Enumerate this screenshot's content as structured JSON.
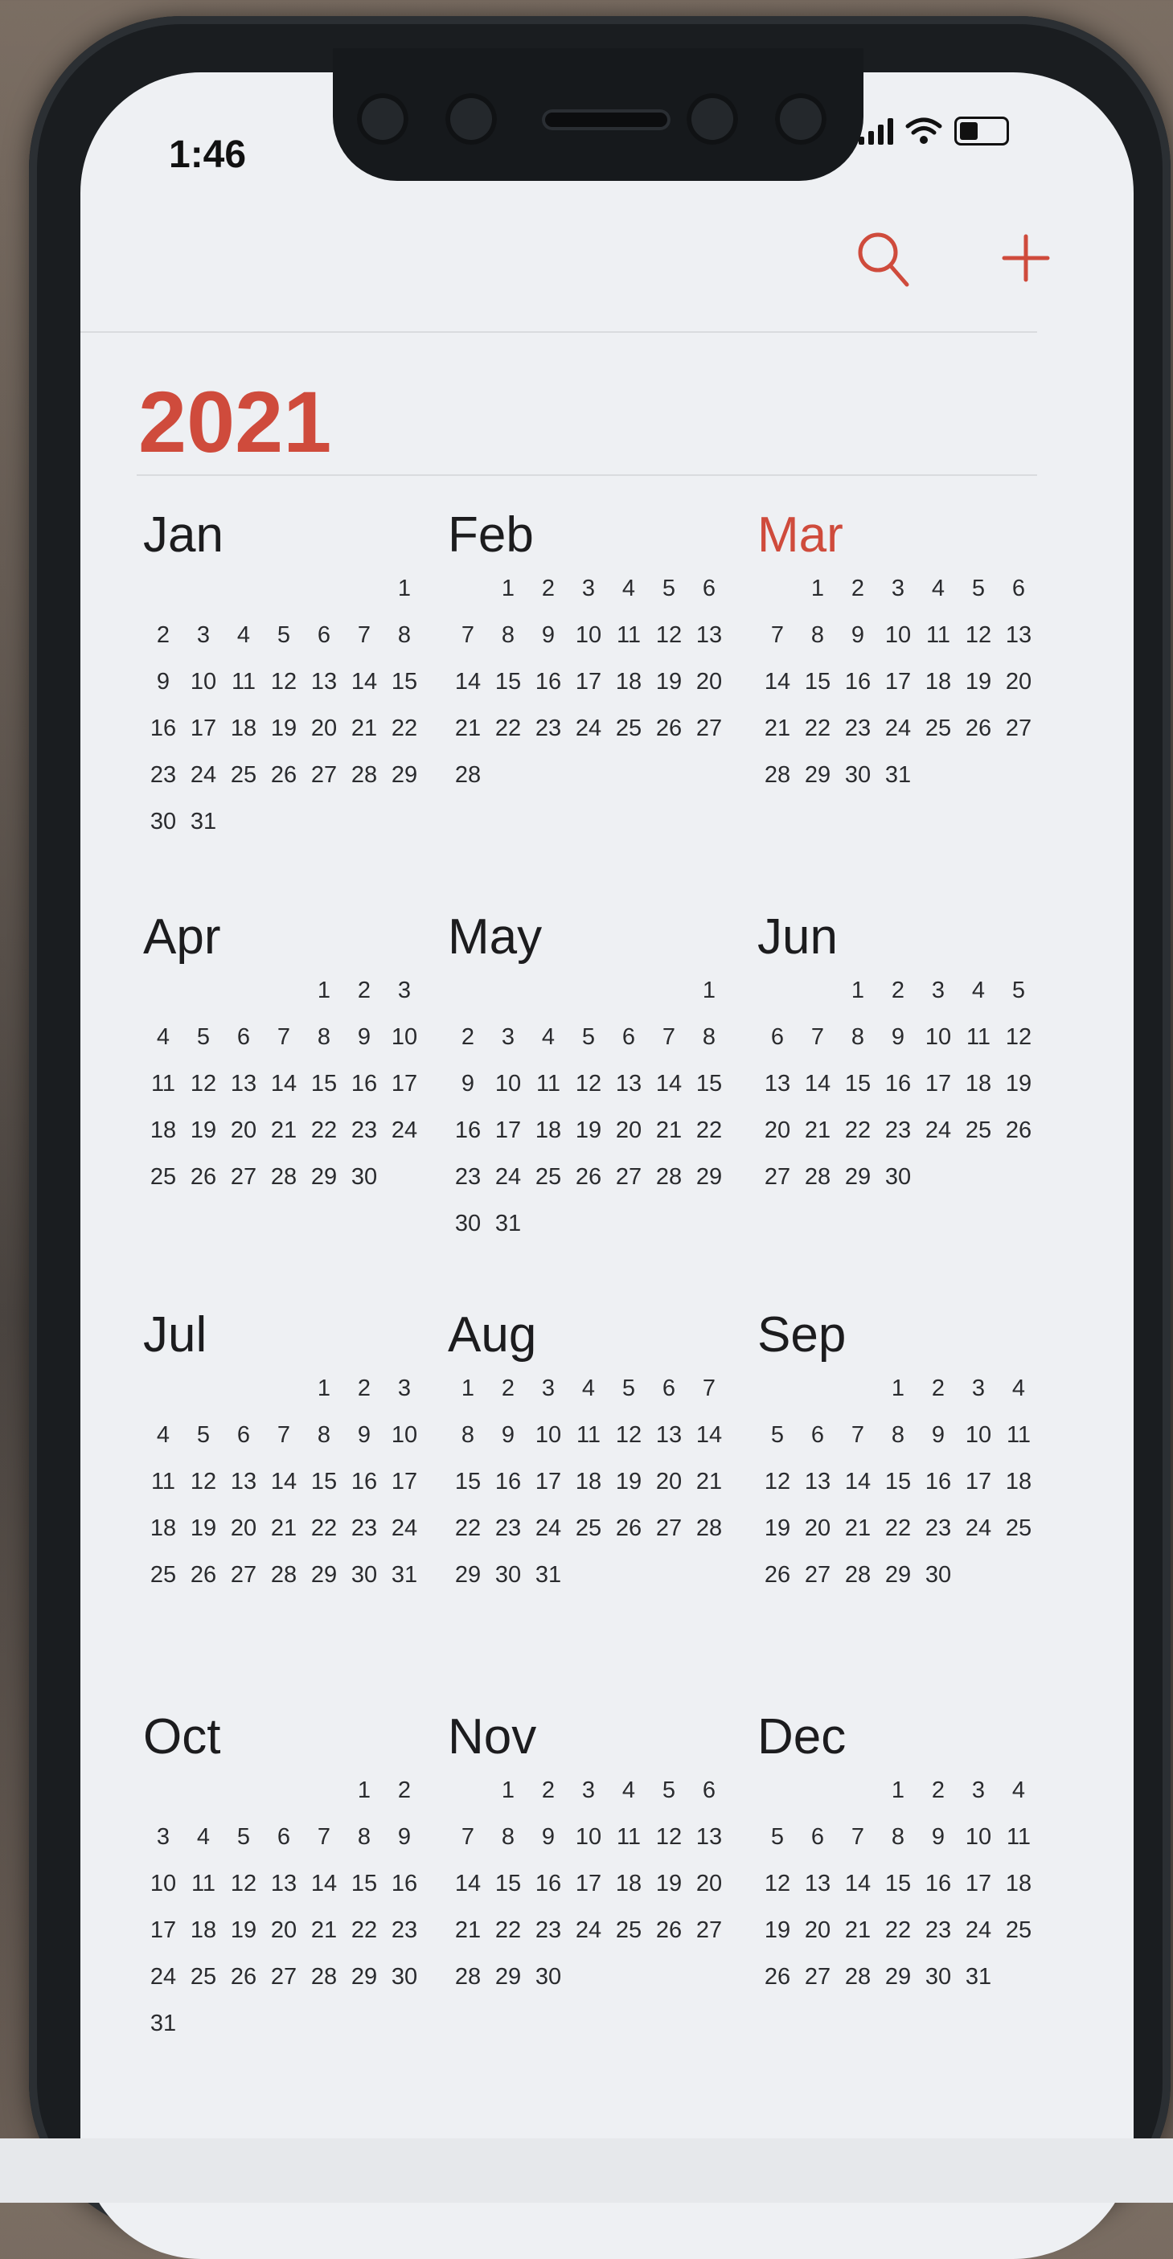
{
  "status_bar": {
    "time": "1:46"
  },
  "toolbar": {
    "search_icon": "search-icon",
    "add_icon": "plus-icon"
  },
  "colors": {
    "accent": "#cf4b3c",
    "text": "#1c1c1e",
    "background": "#eef0f3"
  },
  "year": "2021",
  "current_month": "Mar",
  "months": [
    {
      "name": "Jan",
      "offset": 6,
      "days": 31
    },
    {
      "name": "Feb",
      "offset": 1,
      "days": 28
    },
    {
      "name": "Mar",
      "offset": 1,
      "days": 31
    },
    {
      "name": "Apr",
      "offset": 4,
      "days": 30
    },
    {
      "name": "May",
      "offset": 6,
      "days": 31
    },
    {
      "name": "Jun",
      "offset": 2,
      "days": 30
    },
    {
      "name": "Jul",
      "offset": 4,
      "days": 31
    },
    {
      "name": "Aug",
      "offset": 0,
      "days": 31
    },
    {
      "name": "Sep",
      "offset": 3,
      "days": 30
    },
    {
      "name": "Oct",
      "offset": 5,
      "days": 31
    },
    {
      "name": "Nov",
      "offset": 1,
      "days": 30
    },
    {
      "name": "Dec",
      "offset": 3,
      "days": 31
    }
  ]
}
